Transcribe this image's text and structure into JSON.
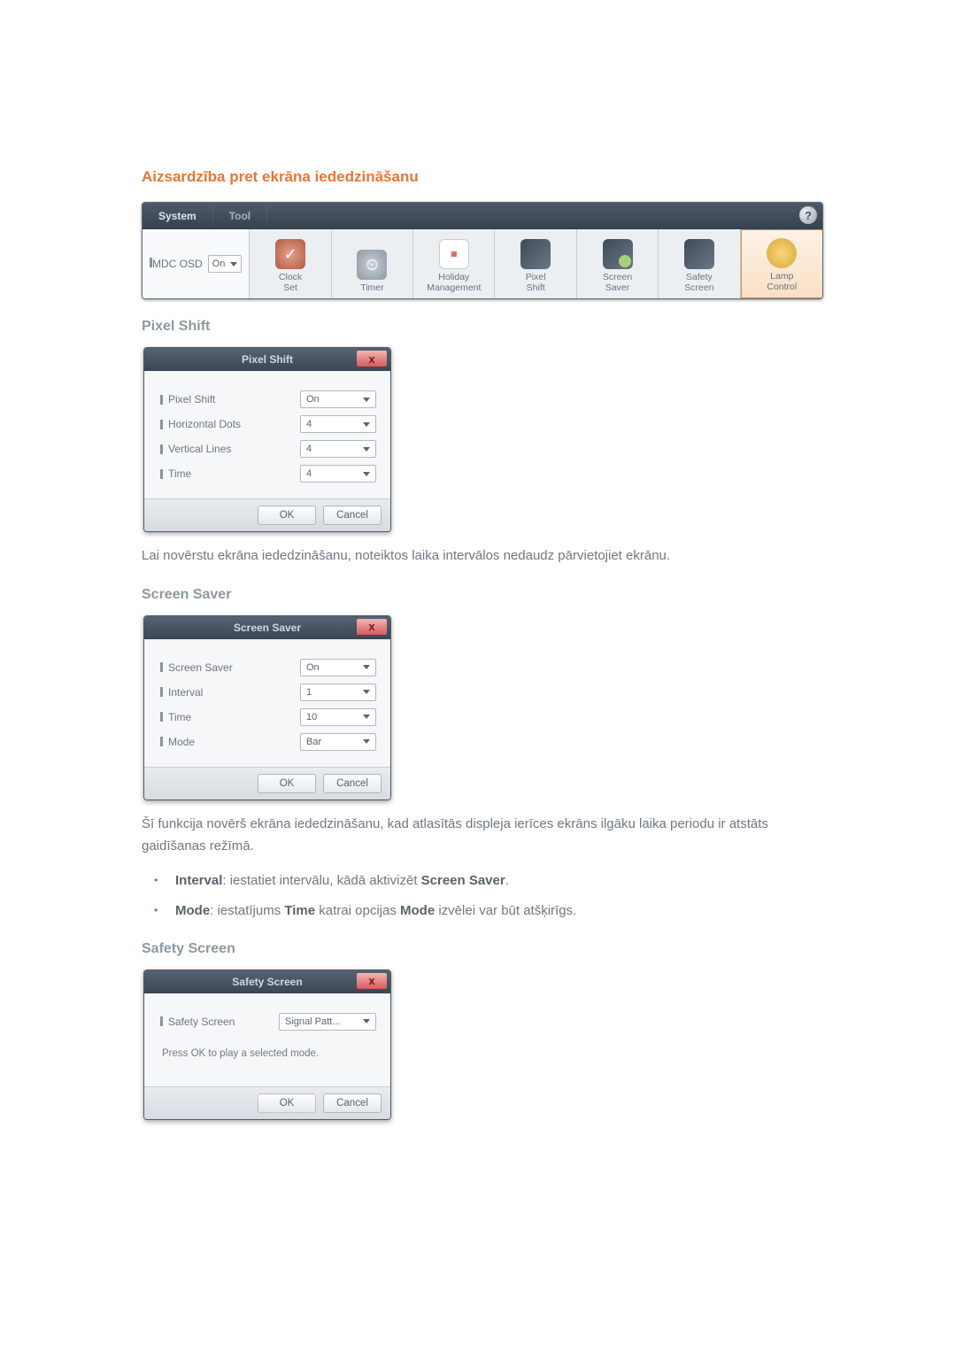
{
  "heading": "Aizsardzība pret ekrāna iededzināšanu",
  "toolbar": {
    "tabs": {
      "system": "System",
      "tool": "Tool"
    },
    "help_glyph": "?",
    "left": {
      "label": "MDC OSD",
      "value": "On"
    },
    "items": [
      {
        "label1": "Clock",
        "label2": "Set"
      },
      {
        "label1": "Timer",
        "label2": ""
      },
      {
        "label1": "Holiday",
        "label2": "Management"
      },
      {
        "label1": "Pixel",
        "label2": "Shift"
      },
      {
        "label1": "Screen",
        "label2": "Saver"
      },
      {
        "label1": "Safety",
        "label2": "Screen"
      },
      {
        "label1": "Lamp",
        "label2": "Control"
      }
    ]
  },
  "pixel_shift": {
    "heading": "Pixel Shift",
    "dialog_title": "Pixel Shift",
    "rows": {
      "pixel_shift": {
        "label": "Pixel Shift",
        "value": "On"
      },
      "h_dots": {
        "label": "Horizontal Dots",
        "value": "4"
      },
      "v_lines": {
        "label": "Vertical Lines",
        "value": "4"
      },
      "time": {
        "label": "Time",
        "value": "4"
      }
    },
    "ok": "OK",
    "cancel": "Cancel",
    "desc": "Lai novērstu ekrāna iededzināšanu, noteiktos laika intervālos nedaudz pārvietojiet ekrānu."
  },
  "screen_saver": {
    "heading": "Screen Saver",
    "dialog_title": "Screen Saver",
    "rows": {
      "screen_saver": {
        "label": "Screen Saver",
        "value": "On"
      },
      "interval": {
        "label": "Interval",
        "value": "1"
      },
      "time": {
        "label": "Time",
        "value": "10"
      },
      "mode": {
        "label": "Mode",
        "value": "Bar"
      }
    },
    "ok": "OK",
    "cancel": "Cancel",
    "desc": "Šī funkcija novērš ekrāna iededzināšanu, kad atlasītās displeja ierīces ekrāns ilgāku laika periodu ir atstāts gaidīšanas režīmā.",
    "bullets": {
      "interval": {
        "strong1": "Interval",
        "text1": ": iestatiet intervālu, kādā aktivizēt ",
        "strong2": "Screen Saver",
        "text2": "."
      },
      "mode": {
        "strong1": "Mode",
        "text1": ": iestatījums ",
        "strong2": "Time",
        "text2": " katrai opcijas ",
        "strong3": "Mode",
        "text3": " izvēlei var būt atšķirīgs."
      }
    }
  },
  "safety_screen": {
    "heading": "Safety Screen",
    "dialog_title": "Safety Screen",
    "rows": {
      "safety_screen": {
        "label": "Safety Screen",
        "value": "Signal Patt..."
      }
    },
    "note": "Press OK to play a selected mode.",
    "ok": "OK",
    "cancel": "Cancel"
  },
  "close_glyph": "x"
}
